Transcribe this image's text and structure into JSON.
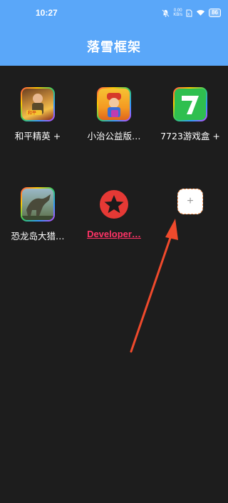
{
  "status_bar": {
    "time": "10:27",
    "net_speed_value": "0.00",
    "net_speed_unit": "KB/s",
    "battery": "86"
  },
  "header": {
    "title": "落雪框架"
  },
  "apps": [
    {
      "label": "和平精英 +",
      "icon": "peace-elite-game-icon"
    },
    {
      "label": "小治公益版…",
      "icon": "subway-surfers-game-icon"
    },
    {
      "label": "7723游戏盒 +",
      "icon": "7723-game-box-icon"
    },
    {
      "label": "恐龙岛大猎…",
      "icon": "dinosaur-island-game-icon"
    },
    {
      "label": "Developer…",
      "icon": "star-badge-icon"
    },
    {
      "label": "+",
      "icon": "add-app-icon"
    }
  ],
  "colors": {
    "header_bg": "#5aa7f9",
    "body_bg": "#1d1d1d",
    "link": "#ff3366",
    "arrow": "#f04a2c"
  }
}
